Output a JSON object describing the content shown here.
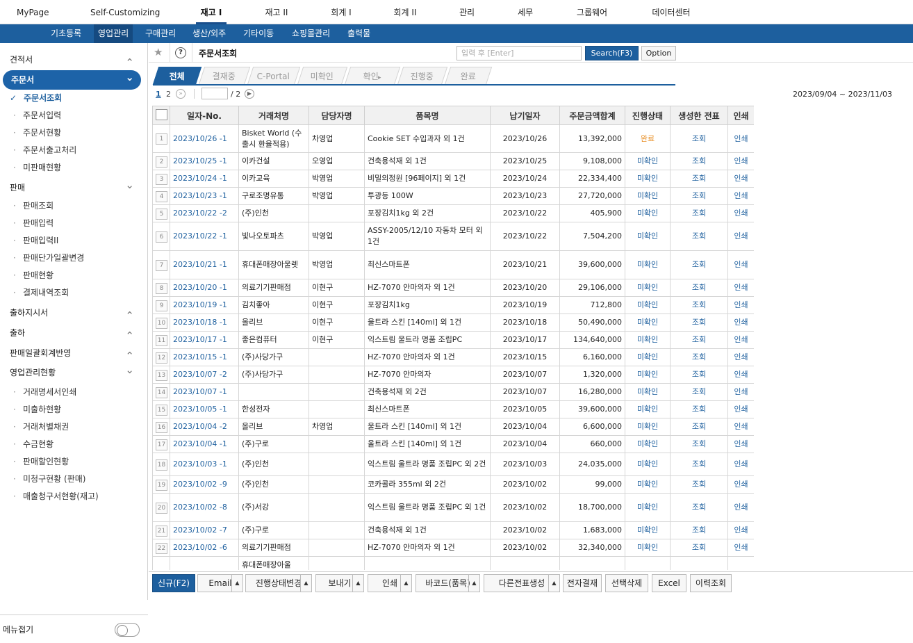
{
  "topnav": [
    "MyPage",
    "Self-Customizing",
    "재고 I",
    "재고 II",
    "회계 I",
    "회계 II",
    "관리",
    "세무",
    "그룹웨어",
    "데이터센터"
  ],
  "subnav": [
    "기초등록",
    "영업관리",
    "구매관리",
    "생산/외주",
    "기타이동",
    "쇼핑몰관리",
    "출력물"
  ],
  "sidebar": {
    "groups": [
      {
        "label": "견적서",
        "state": "up"
      },
      {
        "label": "주문서",
        "state": "down",
        "selected": true
      },
      {
        "label": "판매",
        "state": "down"
      },
      {
        "label": "출하지시서",
        "state": "up"
      },
      {
        "label": "출하",
        "state": "up"
      },
      {
        "label": "판매일괄회계반영",
        "state": "up"
      },
      {
        "label": "영업관리현황",
        "state": "down"
      }
    ],
    "order_items": [
      "주문서조회",
      "주문서입력",
      "주문서현황",
      "주문서출고처리",
      "미판매현황"
    ],
    "sales_items": [
      "판매조회",
      "판매입력",
      "판매입력II",
      "판매단가일괄변경",
      "판매현황",
      "결제내역조회"
    ],
    "status_items": [
      "거래명세서인쇄",
      "미출하현황",
      "거래처별채권",
      "수금현황",
      "판매할인현황",
      "미청구현황 (판매)",
      "매출청구서현황(재고)"
    ],
    "menu_fold": "메뉴접기"
  },
  "header": {
    "title": "주문서조회",
    "search_placeholder": "입력 후 [Enter]",
    "search_btn": "Search(F3)",
    "option_btn": "Option"
  },
  "tabs": [
    "전체",
    "결재중",
    "C-Portal",
    "미확인",
    "확인",
    "진행중",
    "완료"
  ],
  "pager": {
    "p1": "1",
    "p2": "2",
    "total": "/ 2"
  },
  "date_range": "2023/09/04 ~ 2023/11/03",
  "table": {
    "headers": [
      "일자-No.",
      "거래처명",
      "담당자명",
      "품목명",
      "납기일자",
      "주문금액합계",
      "진행상태",
      "생성한 전표",
      "인쇄"
    ],
    "rows": [
      {
        "n": "1",
        "date": "2023/10/26 -1",
        "client": "Bisket World (수출시 환율적용)",
        "mgr": "차영업",
        "item": "Cookie SET 수입과자 외 1건",
        "due": "2023/10/26",
        "amt": "13,392,000",
        "status": "완료",
        "slip": "조회",
        "print": "인쇄"
      },
      {
        "n": "2",
        "date": "2023/10/25 -1",
        "client": "이카건설",
        "mgr": "오영업",
        "item": "건축용석재 외 1건",
        "due": "2023/10/25",
        "amt": "9,108,000",
        "status": "미확인",
        "slip": "조회",
        "print": "인쇄"
      },
      {
        "n": "3",
        "date": "2023/10/24 -1",
        "client": "이카교육",
        "mgr": "박영업",
        "item": "비밀의정원 [96페이지] 외 1건",
        "due": "2023/10/24",
        "amt": "22,334,400",
        "status": "미확인",
        "slip": "조회",
        "print": "인쇄"
      },
      {
        "n": "4",
        "date": "2023/10/23 -1",
        "client": "구로조명유통",
        "mgr": "박영업",
        "item": "투광등 100W",
        "due": "2023/10/23",
        "amt": "27,720,000",
        "status": "미확인",
        "slip": "조회",
        "print": "인쇄"
      },
      {
        "n": "5",
        "date": "2023/10/22 -2",
        "client": "(주)인천",
        "mgr": "",
        "item": "포장김치1kg 외 2건",
        "due": "2023/10/22",
        "amt": "405,900",
        "status": "미확인",
        "slip": "조회",
        "print": "인쇄"
      },
      {
        "n": "6",
        "date": "2023/10/22 -1",
        "client": "빛나오토파츠",
        "mgr": "박영업",
        "item": "ASSY-2005/12/10 자동차 모터 외 1건",
        "due": "2023/10/22",
        "amt": "7,504,200",
        "status": "미확인",
        "slip": "조회",
        "print": "인쇄"
      },
      {
        "n": "7",
        "date": "2023/10/21 -1",
        "client": "휴대폰매장아울렛",
        "mgr": "박영업",
        "item": "최신스마트폰",
        "due": "2023/10/21",
        "amt": "39,600,000",
        "status": "미확인",
        "slip": "조회",
        "print": "인쇄"
      },
      {
        "n": "8",
        "date": "2023/10/20 -1",
        "client": "의료기기판매점",
        "mgr": "이현구",
        "item": "HZ-7070 안마의자 외 1건",
        "due": "2023/10/20",
        "amt": "29,106,000",
        "status": "미확인",
        "slip": "조회",
        "print": "인쇄"
      },
      {
        "n": "9",
        "date": "2023/10/19 -1",
        "client": "김치좋아",
        "mgr": "이현구",
        "item": "포장김치1kg",
        "due": "2023/10/19",
        "amt": "712,800",
        "status": "미확인",
        "slip": "조회",
        "print": "인쇄"
      },
      {
        "n": "10",
        "date": "2023/10/18 -1",
        "client": "올리브",
        "mgr": "이현구",
        "item": "울트라 스킨 [140ml] 외 1건",
        "due": "2023/10/18",
        "amt": "50,490,000",
        "status": "미확인",
        "slip": "조회",
        "print": "인쇄"
      },
      {
        "n": "11",
        "date": "2023/10/17 -1",
        "client": "좋은컴퓨터",
        "mgr": "이현구",
        "item": "익스트림 울트라 명품 조립PC",
        "due": "2023/10/17",
        "amt": "134,640,000",
        "status": "미확인",
        "slip": "조회",
        "print": "인쇄"
      },
      {
        "n": "12",
        "date": "2023/10/15 -1",
        "client": "(주)사당가구",
        "mgr": "",
        "item": "HZ-7070 안마의자 외 1건",
        "due": "2023/10/15",
        "amt": "6,160,000",
        "status": "미확인",
        "slip": "조회",
        "print": "인쇄"
      },
      {
        "n": "13",
        "date": "2023/10/07 -2",
        "client": "(주)사당가구",
        "mgr": "",
        "item": "HZ-7070 안마의자",
        "due": "2023/10/07",
        "amt": "1,320,000",
        "status": "미확인",
        "slip": "조회",
        "print": "인쇄"
      },
      {
        "n": "14",
        "date": "2023/10/07 -1",
        "client": "",
        "mgr": "",
        "item": "건축용석재 외 2건",
        "due": "2023/10/07",
        "amt": "16,280,000",
        "status": "미확인",
        "slip": "조회",
        "print": "인쇄"
      },
      {
        "n": "15",
        "date": "2023/10/05 -1",
        "client": "한성전자",
        "mgr": "",
        "item": "최신스마트폰",
        "due": "2023/10/05",
        "amt": "39,600,000",
        "status": "미확인",
        "slip": "조회",
        "print": "인쇄"
      },
      {
        "n": "16",
        "date": "2023/10/04 -2",
        "client": "올리브",
        "mgr": "차영업",
        "item": "울트라 스킨 [140ml] 외 1건",
        "due": "2023/10/04",
        "amt": "6,600,000",
        "status": "미확인",
        "slip": "조회",
        "print": "인쇄"
      },
      {
        "n": "17",
        "date": "2023/10/04 -1",
        "client": "(주)구로",
        "mgr": "",
        "item": "울트라 스킨 [140ml] 외 1건",
        "due": "2023/10/04",
        "amt": "660,000",
        "status": "미확인",
        "slip": "조회",
        "print": "인쇄"
      },
      {
        "n": "18",
        "date": "2023/10/03 -1",
        "client": "(주)인천",
        "mgr": "",
        "item": "익스트림 울트라 명품 조립PC 외 2건",
        "due": "2023/10/03",
        "amt": "24,035,000",
        "status": "미확인",
        "slip": "조회",
        "print": "인쇄"
      },
      {
        "n": "19",
        "date": "2023/10/02 -9",
        "client": "(주)인천",
        "mgr": "",
        "item": "코카콜라 355ml 외 2건",
        "due": "2023/10/02",
        "amt": "99,000",
        "status": "미확인",
        "slip": "조회",
        "print": "인쇄"
      },
      {
        "n": "20",
        "date": "2023/10/02 -8",
        "client": "(주)서강",
        "mgr": "",
        "item": "익스트림 울트라 명품 조립PC 외 1건",
        "due": "2023/10/02",
        "amt": "18,700,000",
        "status": "미확인",
        "slip": "조회",
        "print": "인쇄"
      },
      {
        "n": "21",
        "date": "2023/10/02 -7",
        "client": "(주)구로",
        "mgr": "",
        "item": "건축용석재 외 1건",
        "due": "2023/10/02",
        "amt": "1,683,000",
        "status": "미확인",
        "slip": "조회",
        "print": "인쇄"
      },
      {
        "n": "22",
        "date": "2023/10/02 -6",
        "client": "의료기기판매점",
        "mgr": "",
        "item": "HZ-7070 안마의자 외 1건",
        "due": "2023/10/02",
        "amt": "32,340,000",
        "status": "미확인",
        "slip": "조회",
        "print": "인쇄"
      },
      {
        "n": "",
        "date": "",
        "client": "휴대폰매장아울",
        "mgr": "",
        "item": "",
        "due": "",
        "amt": "",
        "status": "",
        "slip": "",
        "print": ""
      }
    ]
  },
  "bottom_buttons": [
    {
      "label": "신규(F2)",
      "caret": false,
      "primary": true
    },
    {
      "label": "Email",
      "caret": true
    },
    {
      "label": "진행상태변경",
      "caret": true
    },
    {
      "label": "보내기",
      "caret": true
    },
    {
      "label": "인쇄",
      "caret": true
    },
    {
      "label": "바코드(품목)",
      "caret": true
    },
    {
      "label": "다른전표생성",
      "caret": true
    },
    {
      "label": "전자결재",
      "caret": false
    },
    {
      "label": "선택삭제",
      "caret": false
    },
    {
      "label": "Excel",
      "caret": false
    },
    {
      "label": "이력조회",
      "caret": false
    }
  ]
}
